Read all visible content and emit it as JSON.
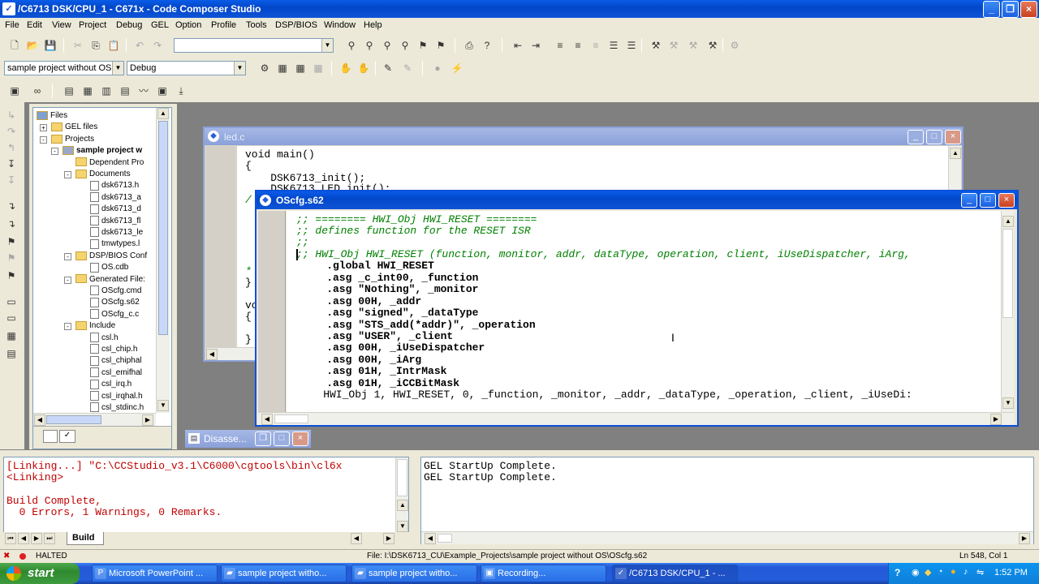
{
  "window": {
    "title": "/C6713 DSK/CPU_1 - C671x - Code Composer Studio",
    "controls": [
      "minimize",
      "restore",
      "close"
    ]
  },
  "menu": [
    "File",
    "Edit",
    "View",
    "Project",
    "Debug",
    "GEL",
    "Option",
    "Profile",
    "Tools",
    "DSP/BIOS",
    "Window",
    "Help"
  ],
  "toolbar": {
    "search_combo_value": "",
    "project_combo_value": "sample project without OS.",
    "config_combo_value": "Debug"
  },
  "tree": {
    "items": [
      {
        "label": "Files",
        "level": 0,
        "type": "root",
        "expander": ""
      },
      {
        "label": "GEL files",
        "level": 1,
        "type": "folder",
        "expander": "+"
      },
      {
        "label": "Projects",
        "level": 1,
        "type": "folder",
        "expander": "-"
      },
      {
        "label": "sample project w",
        "level": 2,
        "type": "project",
        "expander": "-"
      },
      {
        "label": "Dependent Pro",
        "level": 3,
        "type": "folder",
        "expander": ""
      },
      {
        "label": "Documents",
        "level": 3,
        "type": "folder",
        "expander": "-"
      },
      {
        "label": "dsk6713.h",
        "level": 4,
        "type": "file",
        "expander": ""
      },
      {
        "label": "dsk6713_a",
        "level": 4,
        "type": "file",
        "expander": ""
      },
      {
        "label": "dsk6713_d",
        "level": 4,
        "type": "file",
        "expander": ""
      },
      {
        "label": "dsk6713_fl",
        "level": 4,
        "type": "file",
        "expander": ""
      },
      {
        "label": "dsk6713_le",
        "level": 4,
        "type": "file",
        "expander": ""
      },
      {
        "label": "tmwtypes.l",
        "level": 4,
        "type": "file",
        "expander": ""
      },
      {
        "label": "DSP/BIOS Conf",
        "level": 3,
        "type": "folder",
        "expander": "-"
      },
      {
        "label": "OS.cdb",
        "level": 4,
        "type": "file",
        "expander": ""
      },
      {
        "label": "Generated File:",
        "level": 3,
        "type": "folder",
        "expander": "-"
      },
      {
        "label": "OScfg.cmd",
        "level": 4,
        "type": "file",
        "expander": ""
      },
      {
        "label": "OScfg.s62",
        "level": 4,
        "type": "file",
        "expander": ""
      },
      {
        "label": "OScfg_c.c",
        "level": 4,
        "type": "file",
        "expander": ""
      },
      {
        "label": "Include",
        "level": 3,
        "type": "folder",
        "expander": "-"
      },
      {
        "label": "csl.h",
        "level": 4,
        "type": "file",
        "expander": ""
      },
      {
        "label": "csl_chip.h",
        "level": 4,
        "type": "file",
        "expander": ""
      },
      {
        "label": "csl_chiphal",
        "level": 4,
        "type": "file",
        "expander": ""
      },
      {
        "label": "csl_emifhal",
        "level": 4,
        "type": "file",
        "expander": ""
      },
      {
        "label": "csl_irq.h",
        "level": 4,
        "type": "file",
        "expander": ""
      },
      {
        "label": "csl_irqhal.h",
        "level": 4,
        "type": "file",
        "expander": ""
      },
      {
        "label": "csl_stdinc.h",
        "level": 4,
        "type": "file",
        "expander": ""
      }
    ]
  },
  "led_window": {
    "title": "led.c",
    "lines": [
      "void main()",
      "{",
      "    DSK6713_init();",
      "    DSK6713_LED_init();"
    ],
    "fragments": [
      "/",
      "*",
      "}",
      "vo",
      "{",
      "}"
    ]
  },
  "oscfg_window": {
    "title": "OScfg.s62",
    "lines": [
      ";; ======== HWI_Obj HWI_RESET ========",
      ";; defines function for the RESET ISR",
      ";;",
      ";; HWI_Obj HWI_RESET (function, monitor, addr, dataType, operation, client, iUseDispatcher, iArg,",
      "    .global HWI_RESET",
      "    .asg _c_int00, _function",
      "    .asg \"Nothing\", _monitor",
      "    .asg 00H, _addr",
      "    .asg \"signed\", _dataType",
      "    .asg \"STS_add(*addr)\", _operation",
      "    .asg \"USER\", _client",
      "    .asg 00H, _iUseDispatcher",
      "    .asg 00H, _iArg",
      "    .asg 01H, _IntrMask",
      "    .asg 01H, _iCCBitMask",
      "    HWI_Obj 1, HWI_RESET, 0, _function, _monitor, _addr, _dataType, _operation, _client, _iUseDi:"
    ]
  },
  "disasm_window": {
    "title": "Disasse..."
  },
  "output_left": {
    "lines": [
      "[Linking...] \"C:\\CCStudio_v3.1\\C6000\\cgtools\\bin\\cl6x",
      "<Linking>",
      "",
      "Build Complete,",
      "  0 Errors, 1 Warnings, 0 Remarks."
    ],
    "tab": "Build"
  },
  "output_right": {
    "lines": [
      "GEL StartUp Complete.",
      "GEL StartUp Complete."
    ]
  },
  "status": {
    "state": "HALTED",
    "file": "File: I:\\DSK6713_CU\\Example_Projects\\sample project without OS\\OScfg.s62",
    "position": "Ln 548, Col 1"
  },
  "taskbar": {
    "start": "start",
    "items": [
      {
        "label": "Microsoft PowerPoint ...",
        "active": false
      },
      {
        "label": "sample project witho...",
        "active": false
      },
      {
        "label": "sample project witho...",
        "active": false
      },
      {
        "label": "Recording...",
        "active": false
      },
      {
        "label": "/C6713 DSK/CPU_1 - ...",
        "active": true
      }
    ],
    "clock": "1:52 PM"
  },
  "colors": {
    "xp_blue": "#0247c9",
    "comment": "#008000",
    "error_text": "#c00000",
    "face": "#ece9d8"
  }
}
